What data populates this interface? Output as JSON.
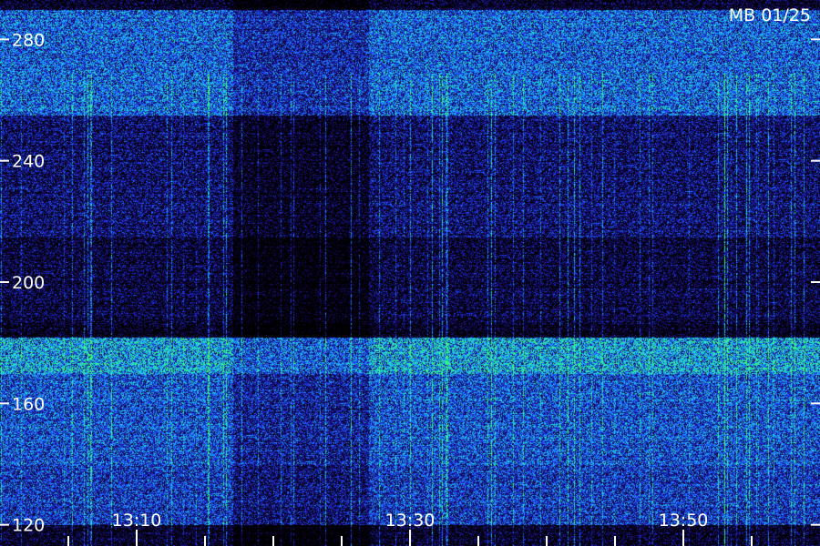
{
  "chart_data": {
    "type": "heatmap",
    "title": "MB 01/25",
    "xlabel": "",
    "ylabel": "",
    "x_tick_labels": [
      "13:10",
      "13:30",
      "13:50"
    ],
    "x_tick_minutes": [
      10,
      30,
      50
    ],
    "x_range_minutes": [
      0,
      60
    ],
    "y_tick_labels": [
      "280",
      "240",
      "200",
      "160",
      "120"
    ],
    "y_tick_values": [
      280,
      240,
      200,
      160,
      120
    ],
    "y_range": [
      113,
      293
    ],
    "grid": false,
    "colormap": [
      "#000000",
      "#1a0a6e",
      "#1e3cff",
      "#1ea0ff",
      "#20e8c8",
      "#40ff60"
    ],
    "intensity_bands": [
      {
        "y_from": 255,
        "y_to": 290,
        "level": 0.55
      },
      {
        "y_from": 215,
        "y_to": 255,
        "level": 0.22
      },
      {
        "y_from": 187,
        "y_to": 215,
        "level": 0.12
      },
      {
        "y_from": 170,
        "y_to": 182,
        "level": 0.72
      },
      {
        "y_from": 140,
        "y_to": 170,
        "level": 0.5
      },
      {
        "y_from": 120,
        "y_to": 140,
        "level": 0.42
      }
    ]
  }
}
